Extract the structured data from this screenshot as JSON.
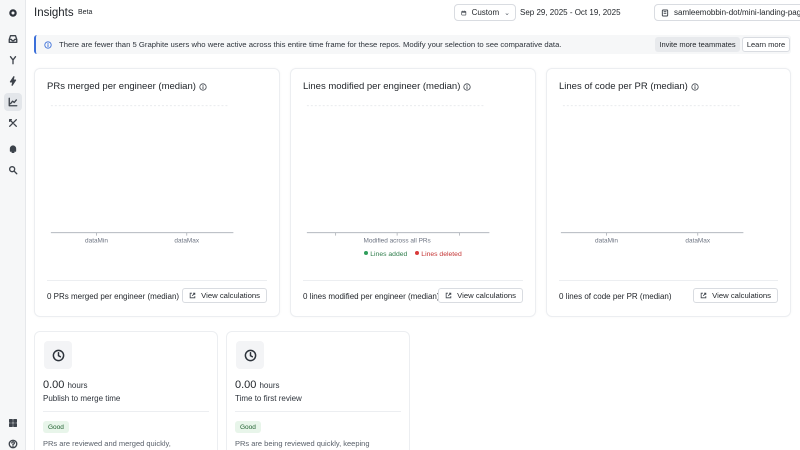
{
  "app": {
    "title": "Insights",
    "badge": "Beta"
  },
  "sidebar": {
    "items": [
      {
        "name": "graphite-logo-icon"
      },
      {
        "name": "inbox-icon"
      },
      {
        "name": "merge-icon"
      },
      {
        "name": "lightning-icon"
      },
      {
        "name": "chart-icon",
        "active": true
      },
      {
        "name": "tools-icon"
      },
      {
        "name": "bell-icon"
      },
      {
        "name": "search-icon"
      },
      {
        "name": "apps-grid-icon"
      },
      {
        "name": "help-icon"
      }
    ]
  },
  "filters": {
    "range_type": "Custom",
    "date_range": "Sep 29, 2025 - Oct 19, 2025",
    "repo": "samleemobbin-dot/mini-landing-page"
  },
  "banner": {
    "message": "There are fewer than 5 Graphite users who were active across this entire time frame for these repos. Modify your selection to see comparative data.",
    "invite_label": "Invite more teammates",
    "learn_label": "Learn more"
  },
  "cards": [
    {
      "title": "PRs merged per engineer (median)",
      "ticks": [
        "dataMin",
        "dataMax"
      ],
      "footer": "0 PRs merged per engineer (median)",
      "button": "View calculations"
    },
    {
      "title": "Lines modified per engineer (median)",
      "xlabel": "Modified across all PRs",
      "legend": [
        {
          "label": "Lines added",
          "color": "#2f9e5b"
        },
        {
          "label": "Lines deleted",
          "color": "#d93a3a"
        }
      ],
      "footer": "0 lines modified per engineer (median)",
      "button": "View calculations"
    },
    {
      "title": "Lines of code per PR (median)",
      "ticks": [
        "dataMin",
        "dataMax"
      ],
      "footer": "0 lines of code per PR (median)",
      "button": "View calculations"
    }
  ],
  "metrics": [
    {
      "value": "0.00",
      "unit": "hours",
      "label": "Publish to merge time",
      "badge": "Good",
      "desc": "PRs are reviewed and merged quickly,"
    },
    {
      "value": "0.00",
      "unit": "hours",
      "label": "Time to first review",
      "badge": "Good",
      "desc": "PRs are being reviewed quickly, keeping"
    }
  ]
}
